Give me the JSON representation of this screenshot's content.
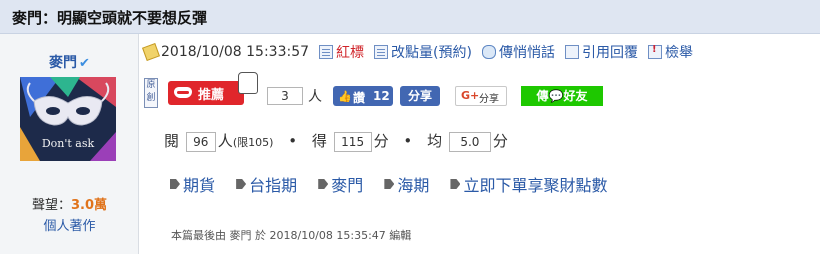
{
  "post": {
    "title": "麥門：明顯空頭就不要想反彈",
    "date": "2018/10/08 15:33:57",
    "edit_note": "本篇最後由 麥門 於 2018/10/08 15:35:47 編輯"
  },
  "toolbar": {
    "mark_label": "紅標",
    "change_points_label": "改點量(預約)",
    "private_message_label": "傳悄悄話",
    "quote_reply_label": "引用回覆",
    "report_label": "檢舉"
  },
  "author": {
    "name": "麥門",
    "avatar_caption": "Don't ask",
    "repute_label": "聲望：",
    "repute_value": "3.0萬",
    "works_label": "個人著作"
  },
  "actions": {
    "original_badge": "原創",
    "push_label": "推薦",
    "push_count": "3",
    "push_unit": "人",
    "fb_like_label": "讚",
    "fb_like_count": "12",
    "fb_share_label": "分享",
    "gplus_label": "分享",
    "line_label": "傳",
    "line_friend": "好友"
  },
  "stats": {
    "read_label": "閱",
    "read_value": "96",
    "read_unit": "人",
    "read_limit": "(限105)",
    "score_label": "得",
    "score_value": "115",
    "score_unit": "分",
    "avg_label": "均",
    "avg_value": "5.0",
    "avg_unit": "分"
  },
  "tags": [
    "期貨",
    "台指期",
    "麥門",
    "海期",
    "立即下單享聚財點數"
  ],
  "colors": {
    "link": "#2b5aa7",
    "mark_red": "#d0242a",
    "push_red": "#e0262b",
    "facebook": "#4267b2",
    "line_green": "#1ec800",
    "repute_orange": "#e0731b"
  }
}
